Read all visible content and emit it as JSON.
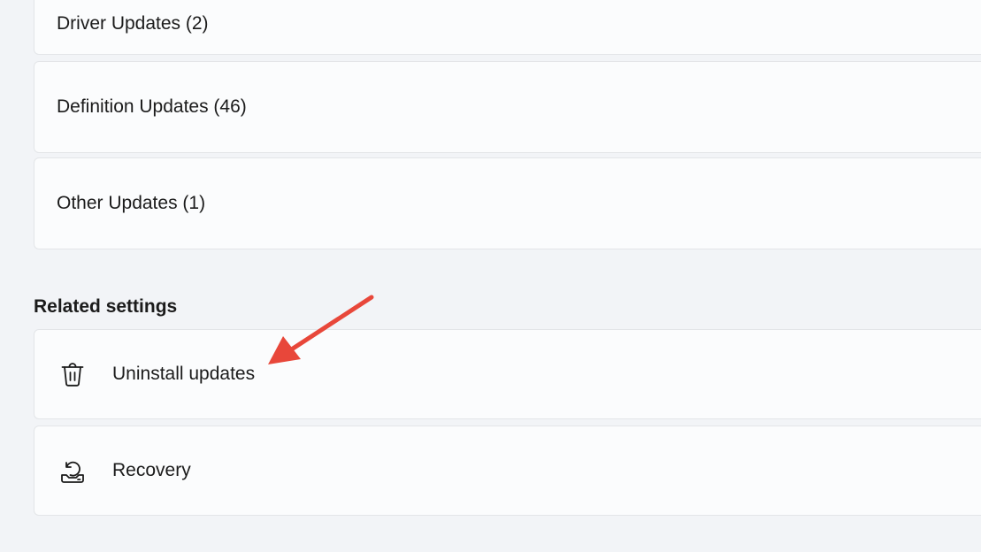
{
  "updates": {
    "driver": "Driver Updates (2)",
    "definition": "Definition Updates (46)",
    "other": "Other Updates (1)"
  },
  "related": {
    "title": "Related settings",
    "uninstall": {
      "label": "Uninstall updates",
      "icon": "trash-icon"
    },
    "recovery": {
      "label": "Recovery",
      "icon": "recovery-icon"
    }
  },
  "annotation": {
    "icon": "arrow-annotation",
    "color": "#e8473a"
  },
  "colors": {
    "background": "#f2f4f7",
    "card": "#fbfcfd",
    "card_border": "#e3e5e8",
    "text": "#1b1b1b"
  }
}
